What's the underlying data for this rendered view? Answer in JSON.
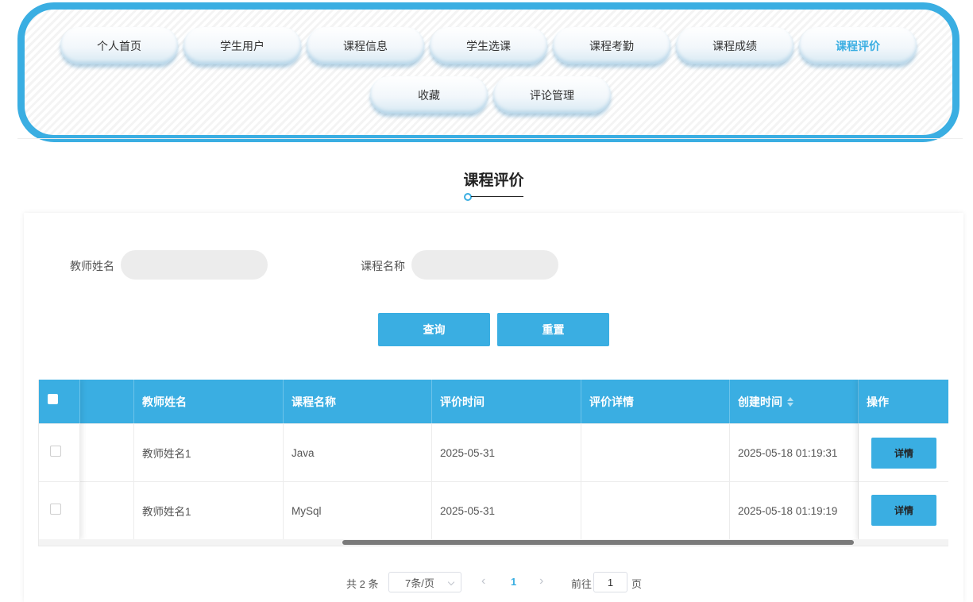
{
  "nav": {
    "row1": [
      "个人首页",
      "学生用户",
      "课程信息",
      "学生选课",
      "课程考勤",
      "课程成绩",
      "课程评价"
    ],
    "row2": [
      "收藏",
      "评论管理"
    ],
    "active": "课程评价"
  },
  "page": {
    "title": "课程评价"
  },
  "search": {
    "teacher_label": "教师姓名",
    "teacher_value": "",
    "course_label": "课程名称",
    "course_value": "",
    "query_label": "查询",
    "reset_label": "重置"
  },
  "table": {
    "headers": {
      "teacher": "教师姓名",
      "course": "课程名称",
      "eval_time": "评价时间",
      "eval_detail": "评价详情",
      "created": "创建时间",
      "action": "操作"
    },
    "rows": [
      {
        "teacher": "教师姓名1",
        "course": "Java",
        "eval_time": "2025-05-31",
        "eval_detail": "",
        "created": "2025-05-18 01:19:31",
        "action": "详情"
      },
      {
        "teacher": "教师姓名1",
        "course": "MySql",
        "eval_time": "2025-05-31",
        "eval_detail": "",
        "created": "2025-05-18 01:19:19",
        "action": "详情"
      }
    ]
  },
  "pagination": {
    "total": "共 2 条",
    "page_size": "7条/页",
    "current": "1",
    "goto_label": "前往",
    "goto_value": "1",
    "unit": "页"
  },
  "colors": {
    "accent": "#3aaee2"
  }
}
